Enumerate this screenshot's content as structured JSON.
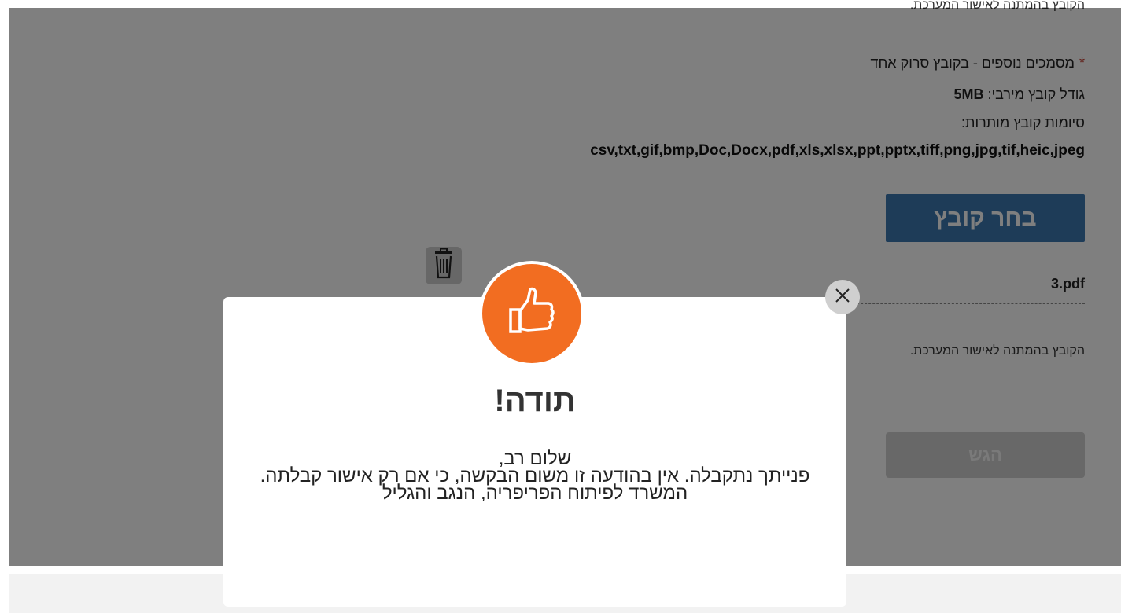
{
  "form": {
    "cut_text": "הקובץ בהמתנה לאישור המערכת.",
    "doc_required_marker": "*",
    "doc_label": "מסמכים נוספים - בקובץ סרוק אחד",
    "max_size_label": "גודל קובץ מירבי:",
    "max_size_value": "5MB",
    "extensions_label": "סיומות קובץ מותרות:",
    "extensions_list": "csv,txt,gif,bmp,Doc,Docx,pdf,xls,xlsx,ppt,pptx,tiff,png,jpg,tif,heic,jpeg",
    "choose_file_label": "בחר קובץ",
    "file_name": "3.pdf",
    "pending_message": "הקובץ בהמתנה לאישור המערכת.",
    "submit_label": "הגש"
  },
  "modal": {
    "title": "תודה!",
    "greeting": "שלום רב,",
    "line1": "פנייתך נתקבלה. אין בהודעה זו משום הבקשה, כי אם רק אישור קבלתה.",
    "line2": "המשרד לפיתוח הפריפריה, הנגב והגליל"
  },
  "icons": {
    "thumb": "thumbs-up-icon",
    "close": "close-icon",
    "trash": "trash-icon"
  },
  "colors": {
    "accent_orange": "#f26d21",
    "button_blue": "#3d78b1",
    "required_red": "#c0392b"
  }
}
